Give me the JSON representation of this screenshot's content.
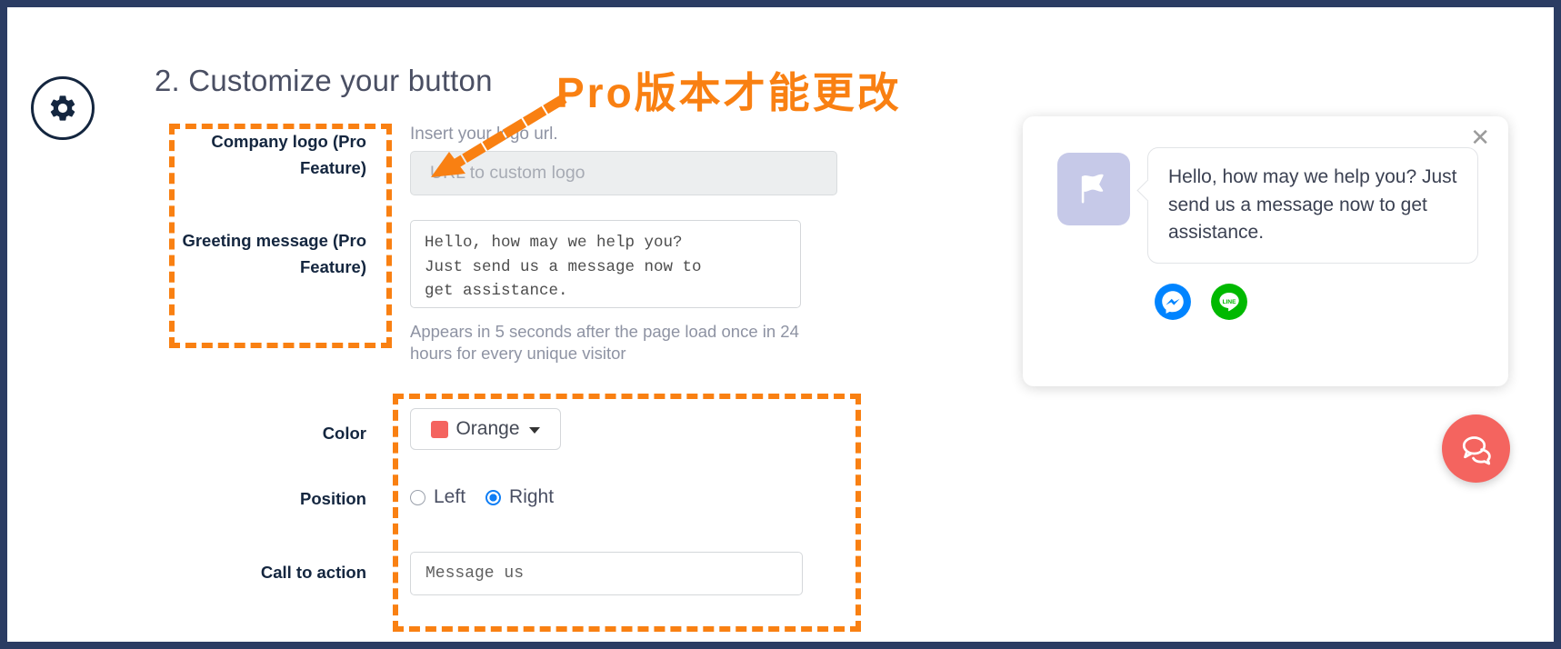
{
  "section": {
    "heading": "2. Customize your button",
    "gear_icon": "gear-icon"
  },
  "fields": {
    "company_logo": {
      "label": "Company logo (Pro Feature)",
      "helper": "Insert your logo url.",
      "input_placeholder": "URL to custom logo",
      "input_value": ""
    },
    "greeting_message": {
      "label": "Greeting message (Pro Feature)",
      "value": "Hello, how may we help you?\nJust send us a message now to\nget assistance.",
      "helper": "Appears in 5 seconds after the page load once in 24 hours for every unique visitor"
    },
    "color": {
      "label": "Color",
      "selected": "Orange",
      "swatch_hex": "#f4645f",
      "caret_icon": "chevron-down-icon"
    },
    "position": {
      "label": "Position",
      "options": [
        {
          "label": "Left",
          "checked": false
        },
        {
          "label": "Right",
          "checked": true
        }
      ]
    },
    "call_to_action": {
      "label": "Call to action",
      "placeholder": "Message us",
      "value": "Message us"
    }
  },
  "annotations": {
    "note_text": "Pro版本才能更改",
    "note_color": "#f98012",
    "box_color": "#f98012",
    "arrow_icon": "dotted-arrow-icon"
  },
  "preview": {
    "close_icon": "close-icon",
    "avatar_icon": "flag-icon",
    "avatar_bg": "#c6c9e8",
    "message": "Hello, how may we help you? Just send us a message now to get assistance.",
    "socials": [
      {
        "name": "messenger-icon",
        "label": "Messenger",
        "color": "#0084ff"
      },
      {
        "name": "line-icon",
        "label": "LINE",
        "color": "#00b900"
      }
    ]
  },
  "fab": {
    "icon": "chat-bubbles-icon",
    "color": "#f4645f"
  },
  "theme": {
    "frame_border": "#2b3c63",
    "heading_color": "#4a4f63",
    "label_color": "#14263f",
    "helper_color": "#8e93a3",
    "radio_checked": "#0f7ef5"
  }
}
